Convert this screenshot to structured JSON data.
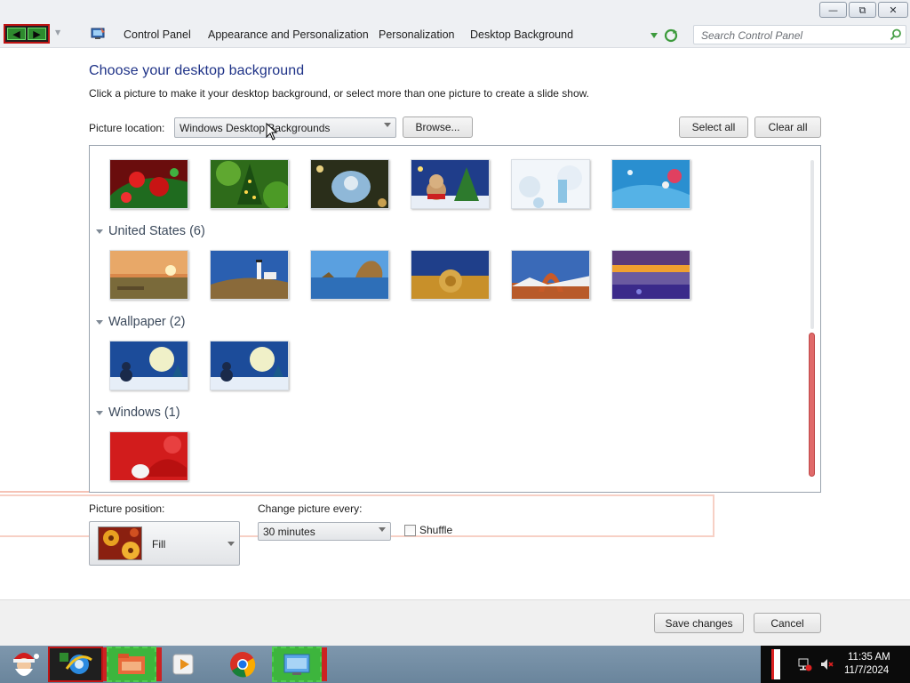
{
  "window": {
    "minimize_icon": "minimize-icon",
    "restore_icon": "restore-icon",
    "close_icon": "close-icon"
  },
  "address_bar": {
    "back_icon": "back-arrow-icon",
    "forward_icon": "forward-arrow-icon",
    "breadcrumbs": [
      "Control Panel",
      "Appearance and Personalization",
      "Personalization",
      "Desktop Background"
    ],
    "search_placeholder": "Search Control Panel"
  },
  "page": {
    "title": "Choose your desktop background",
    "instructions": "Click a picture to make it your desktop background, or select more than one picture to create a slide show."
  },
  "location": {
    "label": "Picture location:",
    "selected": "Windows Desktop Backgrounds",
    "browse_label": "Browse...",
    "select_all_label": "Select all",
    "clear_all_label": "Clear all"
  },
  "gallery": {
    "groups": [
      {
        "title": "",
        "thumbnails": [
          "red-ornaments",
          "green-christmas-tree",
          "fairy-lights",
          "christmas-bear",
          "snowy-ice",
          "blue-ribbon"
        ]
      },
      {
        "title": "United States (6)",
        "thumbnails": [
          "sunset-field",
          "lighthouse",
          "haystack-rock",
          "hay-bale",
          "delicate-arch",
          "lake-sunset"
        ]
      },
      {
        "title": "Wallpaper (2)",
        "thumbnails": [
          "snowman-night-1",
          "snowman-night-2"
        ]
      },
      {
        "title": "Windows (1)",
        "thumbnails": [
          "santa-hat"
        ]
      }
    ]
  },
  "options": {
    "position_label": "Picture position:",
    "position_value": "Fill",
    "interval_label": "Change picture every:",
    "interval_value": "30 minutes",
    "shuffle_label": "Shuffle",
    "shuffle_checked": false
  },
  "footer": {
    "save_label": "Save changes",
    "cancel_label": "Cancel"
  },
  "taskbar": {
    "items": [
      "start-santa",
      "internet-explorer",
      "file-explorer",
      "media-player",
      "chrome",
      "control-panel"
    ],
    "clock_time": "11:35 AM",
    "clock_date": "11/7/2024"
  },
  "colors": {
    "heading": "#1e3287",
    "taskbar": "#6f8aa1",
    "tray": "#0b0b0b"
  }
}
